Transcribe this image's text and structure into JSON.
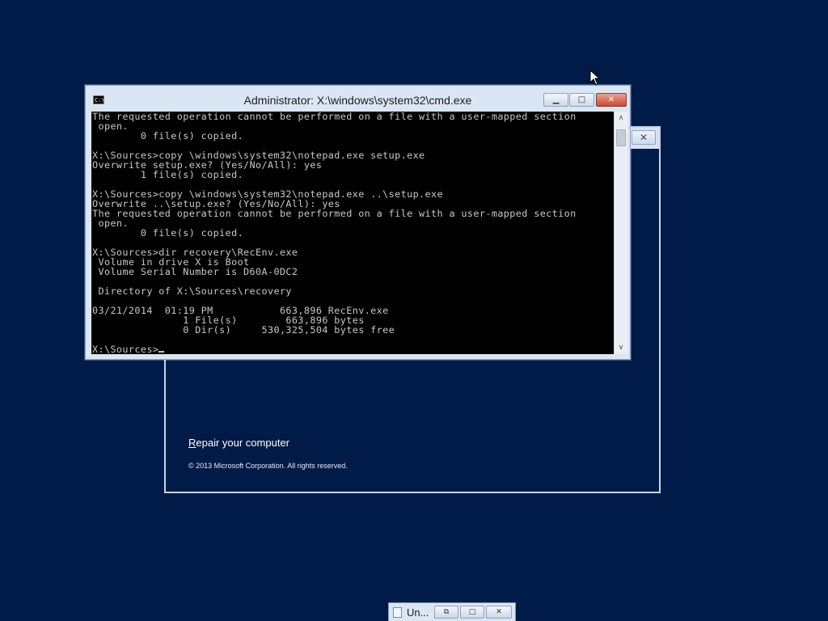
{
  "setup_window": {
    "close_glyph": "✕",
    "repair_link_first": "R",
    "repair_link_rest": "epair your computer",
    "copyright": "© 2013 Microsoft Corporation. All rights reserved."
  },
  "cmd_window": {
    "icon_text": "C:\\",
    "title": "Administrator: X:\\windows\\system32\\cmd.exe",
    "minimize_glyph": "▁",
    "maximize_glyph": "□",
    "close_glyph": "✕",
    "console_text": "The requested operation cannot be performed on a file with a user-mapped section\n open.\n        0 file(s) copied.\n\nX:\\Sources>copy \\windows\\system32\\notepad.exe setup.exe\nOverwrite setup.exe? (Yes/No/All): yes\n        1 file(s) copied.\n\nX:\\Sources>copy \\windows\\system32\\notepad.exe ..\\setup.exe\nOverwrite ..\\setup.exe? (Yes/No/All): yes\nThe requested operation cannot be performed on a file with a user-mapped section\n open.\n        0 file(s) copied.\n\nX:\\Sources>dir recovery\\RecEnv.exe\n Volume in drive X is Boot\n Volume Serial Number is D60A-0DC2\n\n Directory of X:\\Sources\\recovery\n\n03/21/2014  01:19 PM           663,896 RecEnv.exe\n               1 File(s)        663,896 bytes\n               0 Dir(s)     530,325,504 bytes free\n\n",
    "prompt": "X:\\Sources>",
    "scroll_up_glyph": "∧",
    "scroll_down_glyph": "∨"
  },
  "taskbar": {
    "label": "Un...",
    "restore_glyph": "⧉",
    "maximize_glyph": "□",
    "close_glyph": "✕"
  },
  "colors": {
    "desktop_background": "#011b48",
    "console_background": "#000000",
    "console_text": "#c8c8c8",
    "close_button": "#c94a35"
  }
}
